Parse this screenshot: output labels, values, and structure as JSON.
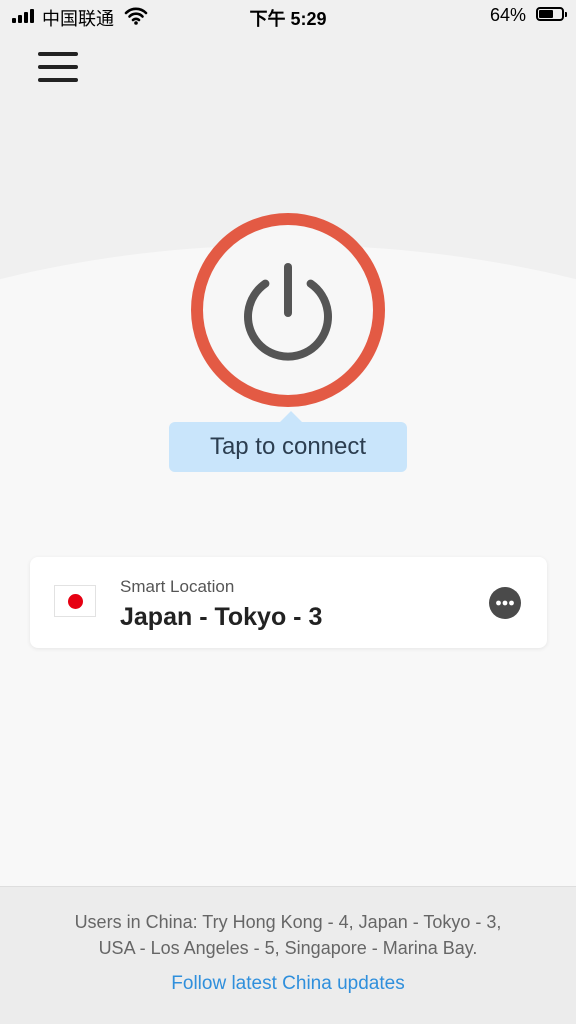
{
  "status_bar": {
    "carrier": "中国联通",
    "time": "下午 5:29",
    "battery_percent": "64%",
    "battery_level": 0.64,
    "icons": [
      "signal-icon",
      "wifi-icon",
      "battery-icon"
    ]
  },
  "header": {
    "menu_icon": "hamburger-menu-icon"
  },
  "connect": {
    "power_icon": "power-icon",
    "tooltip": "Tap to connect",
    "colors": {
      "ring": "#e35a44",
      "tooltip_bg": "#c9e5fb",
      "icon": "#555555"
    }
  },
  "location": {
    "label": "Smart Location",
    "name": "Japan - Tokyo - 3",
    "flag_icon": "japan-flag-icon",
    "more_icon": "more-options-icon"
  },
  "footer": {
    "notice_line1": "Users in China: Try Hong Kong - 4, Japan - Tokyo - 3,",
    "notice_line2": "USA - Los Angeles - 5, Singapore - Marina Bay.",
    "link": "Follow latest China updates",
    "link_color": "#2f8fdc"
  }
}
